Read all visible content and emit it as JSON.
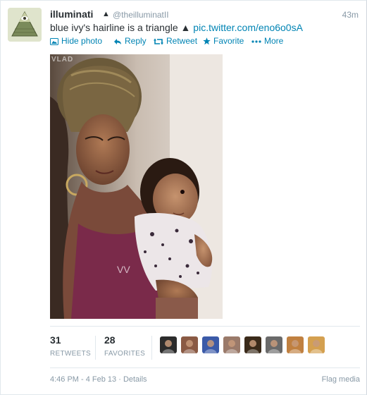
{
  "tweet": {
    "fullname": "illuminati",
    "verified_glyph": "▲",
    "username": "@theilluminatII",
    "time": "43m",
    "text": "blue ivy's hairline is a triangle ▲ ",
    "link_text": "pic.twitter.com/eno6o0sA",
    "avatar_icon": "all-seeing-eye-pyramid-icon"
  },
  "actions": {
    "hide_photo": "Hide photo",
    "reply": "Reply",
    "retweet": "Retweet",
    "favorite": "Favorite",
    "more": "More"
  },
  "photo": {
    "watermark": "VLAD"
  },
  "stats": {
    "retweets_count": "31",
    "retweets_label": "RETWEETS",
    "favorites_count": "28",
    "favorites_label": "FAVORITES"
  },
  "favoriters": [
    {
      "name": "favoriter-avatar-1",
      "color": "#2c2c2c"
    },
    {
      "name": "favoriter-avatar-2",
      "color": "#8a5a44"
    },
    {
      "name": "favoriter-avatar-3",
      "color": "#3b5aa8"
    },
    {
      "name": "favoriter-avatar-4",
      "color": "#9a7a6a"
    },
    {
      "name": "favoriter-avatar-5",
      "color": "#3a2a1a"
    },
    {
      "name": "favoriter-avatar-6",
      "color": "#6a6a6a"
    },
    {
      "name": "favoriter-avatar-7",
      "color": "#c08040"
    },
    {
      "name": "favoriter-avatar-8",
      "color": "#d4a050"
    }
  ],
  "footer": {
    "timestamp": "4:46 PM - 4 Feb 13 · ",
    "details": "Details",
    "flag_media": "Flag media"
  },
  "colors": {
    "link": "#0084b4",
    "muted": "#8899a6",
    "text": "#292f33"
  }
}
